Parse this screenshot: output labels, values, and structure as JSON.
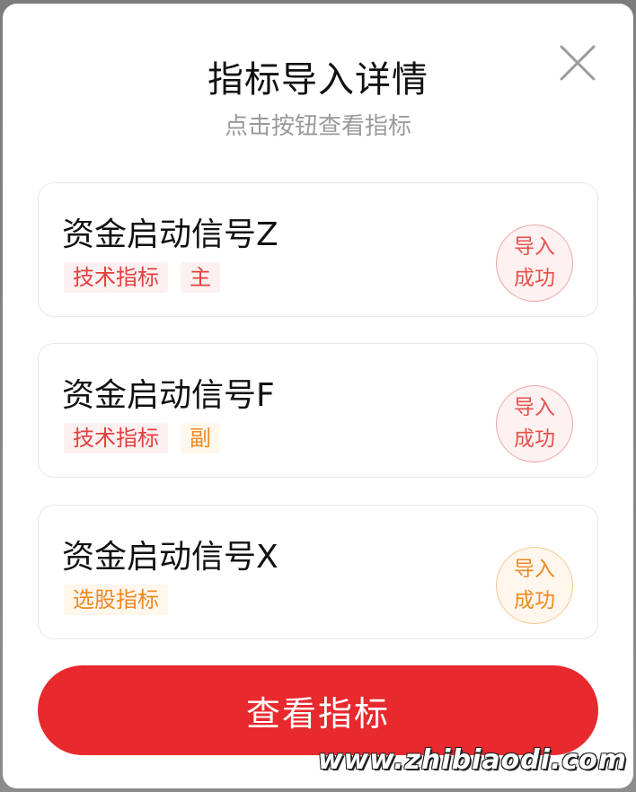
{
  "modal": {
    "title": "指标导入详情",
    "subtitle": "点击按钮查看指标",
    "close_icon": "close-icon"
  },
  "cards": [
    {
      "name": "资金启动信号Z",
      "tags": [
        "技术指标",
        "主"
      ],
      "tag_colors": [
        "red",
        "red"
      ],
      "status_line1": "导入",
      "status_line2": "成功",
      "status_color": "red"
    },
    {
      "name": "资金启动信号F",
      "tags": [
        "技术指标",
        "副"
      ],
      "tag_colors": [
        "red",
        "orange"
      ],
      "status_line1": "导入",
      "status_line2": "成功",
      "status_color": "red"
    },
    {
      "name": "资金启动信号X",
      "tags": [
        "选股指标"
      ],
      "tag_colors": [
        "orange"
      ],
      "status_line1": "导入",
      "status_line2": "成功",
      "status_color": "orange"
    }
  ],
  "cta": {
    "label": "查看指标"
  },
  "watermark": "www.zhibiaodi.com",
  "colors": {
    "primary_red": "#e8292e",
    "tag_red": "#e2413f",
    "tag_orange": "#ef8a21"
  }
}
